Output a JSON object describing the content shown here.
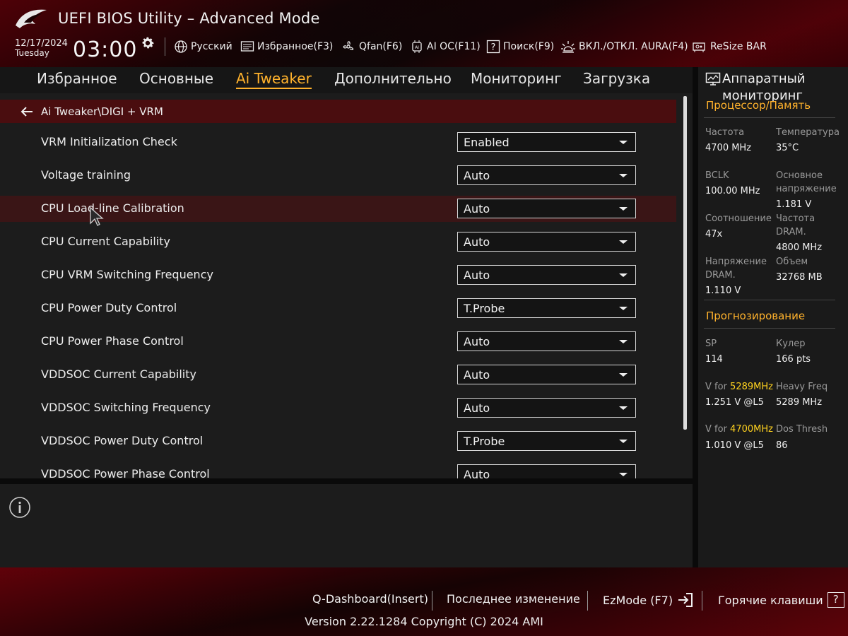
{
  "header": {
    "title": "UEFI BIOS Utility – Advanced Mode",
    "date": "12/17/2024",
    "day": "Tuesday",
    "time": "03:00"
  },
  "toolbar": [
    {
      "id": "language",
      "label": "Русский",
      "icon": "globe-icon"
    },
    {
      "id": "favorites",
      "label": "Избранное(F3)",
      "icon": "favorites-icon"
    },
    {
      "id": "qfan",
      "label": "Qfan(F6)",
      "icon": "fan-icon"
    },
    {
      "id": "aioc",
      "label": "AI OC(F11)",
      "icon": "ai-chip-icon"
    },
    {
      "id": "search",
      "label": "Поиск(F9)",
      "icon": "help-search-icon"
    },
    {
      "id": "aura",
      "label": "ВКЛ./ОТКЛ. AURA(F4)",
      "icon": "aura-light-icon"
    },
    {
      "id": "resizebar",
      "label": "ReSize BAR",
      "icon": "resize-bar-icon"
    }
  ],
  "tabs": [
    {
      "label": "Избранное",
      "active": false
    },
    {
      "label": "Основные",
      "active": false
    },
    {
      "label": "Ai Tweaker",
      "active": true
    },
    {
      "label": "Дополнительно",
      "active": false
    },
    {
      "label": "Мониторинг",
      "active": false
    },
    {
      "label": "Загрузка",
      "active": false
    }
  ],
  "breadcrumb": "Ai Tweaker\\DIGI + VRM",
  "settings": [
    {
      "label": "VRM Initialization Check",
      "value": "Enabled"
    },
    {
      "label": "Voltage training",
      "value": "Auto"
    },
    {
      "label": "CPU Load-line Calibration",
      "value": "Auto",
      "highlighted": true
    },
    {
      "label": "CPU Current Capability",
      "value": "Auto"
    },
    {
      "label": "CPU VRM Switching Frequency",
      "value": "Auto"
    },
    {
      "label": "CPU Power Duty Control",
      "value": "T.Probe"
    },
    {
      "label": "CPU Power Phase Control",
      "value": "Auto"
    },
    {
      "label": "VDDSOC Current Capability",
      "value": "Auto"
    },
    {
      "label": "VDDSOC Switching Frequency",
      "value": "Auto"
    },
    {
      "label": "VDDSOC Power Duty Control",
      "value": "T.Probe"
    },
    {
      "label": "VDDSOC Power Phase Control",
      "value": "Auto"
    }
  ],
  "hw_monitor": {
    "title": "Аппаратный мониторинг",
    "section_cpu": "Процессор/Память",
    "cpu": {
      "freq_label": "Частота",
      "freq_value": "4700 MHz",
      "temp_label": "Температура",
      "temp_value": "35°C",
      "bclk_label": "BCLK",
      "bclk_value": "100.00 MHz",
      "core_v_label": "Основное напряжение",
      "core_v_value": "1.181 V",
      "ratio_label": "Соотношение",
      "ratio_value": "47x",
      "dram_freq_label": "Частота DRAM.",
      "dram_freq_value": "4800 MHz",
      "dram_v_label": "Напряжение DRAM.",
      "dram_v_value": "1.110 V",
      "capacity_label": "Объем",
      "capacity_value": "32768 MB"
    },
    "section_prediction": "Прогнозирование",
    "prediction": {
      "sp_label": "SP",
      "sp_value": "114",
      "cooler_label": "Кулер",
      "cooler_value": "166 pts",
      "v1_prefix": "V for",
      "v1_freq": "5289MHz",
      "v1_value": "1.251 V @L5",
      "heavy_label": "Heavy Freq",
      "heavy_value": "5289 MHz",
      "v2_prefix": "V for",
      "v2_freq": "4700MHz",
      "v2_value": "1.010 V @L5",
      "dos_label": "Dos Thresh",
      "dos_value": "86"
    }
  },
  "footer": {
    "qdashboard": "Q-Dashboard(Insert)",
    "last_change": "Последнее изменение",
    "ezmode": "EzMode (F7)",
    "hotkeys": "Горячие клавиши",
    "hotkeys_icon": "?",
    "copyright": "Version 2.22.1284 Copyright (C) 2024 AMI"
  },
  "colors": {
    "accent": "#ffb22c",
    "highlight_value": "#ffd21f",
    "breadcrumb_bg": "#4a0d0f",
    "row_highlight": "#3a1516"
  }
}
